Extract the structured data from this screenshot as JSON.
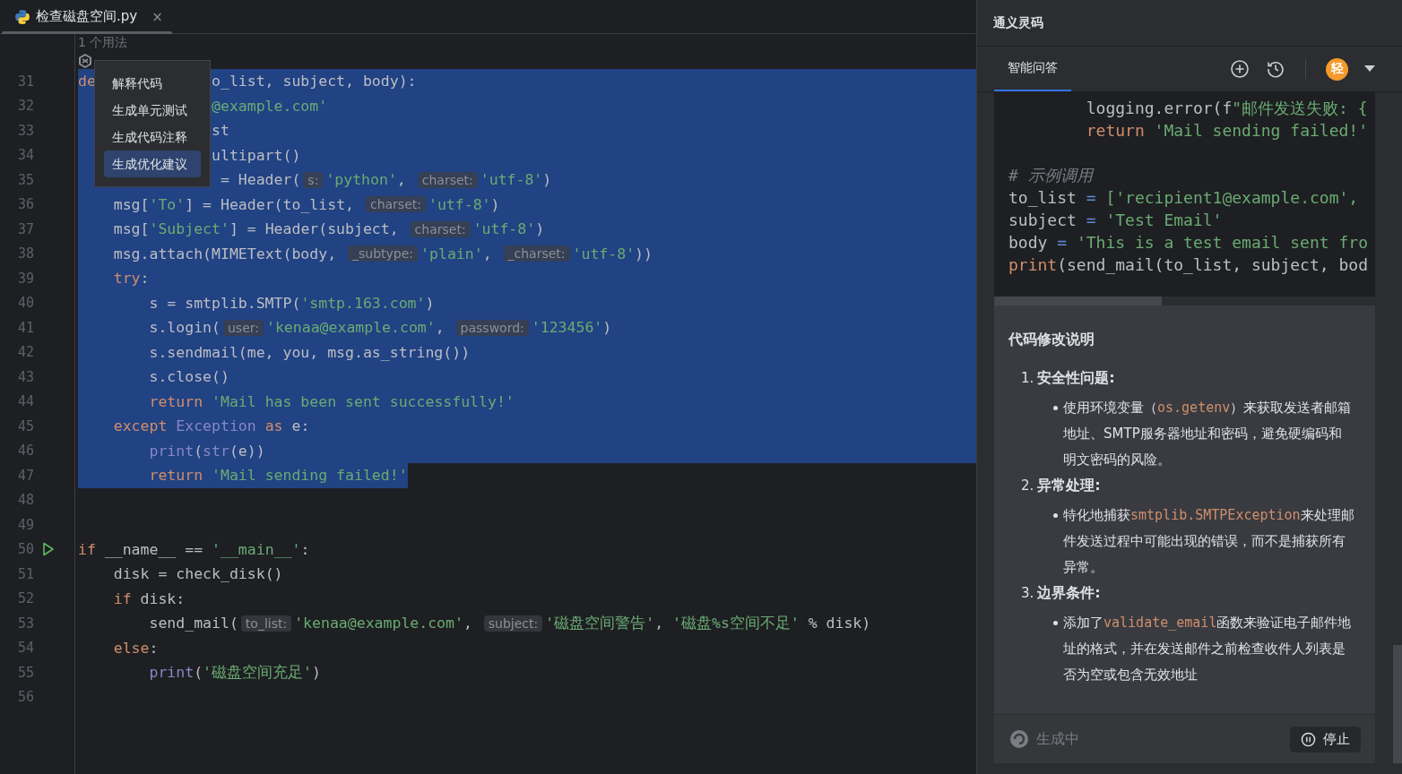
{
  "editor_tab": {
    "label": "检查磁盘空间.py",
    "close": "×",
    "selected": true
  },
  "editor": {
    "usages": "1 个用法",
    "lines": [
      {
        "no": "31",
        "selected": true,
        "tokens": [
          {
            "t": "de",
            "kind": "kw"
          },
          {
            "t": "             o_list, subject, body):",
            "kind": "plain"
          }
        ]
      },
      {
        "no": "32",
        "selected": true,
        "tokens": [
          {
            "t": "               @example.com'",
            "kind": "str"
          }
        ]
      },
      {
        "no": "33",
        "selected": true,
        "tokens": [
          {
            "t": "               st",
            "kind": "plain"
          }
        ]
      },
      {
        "no": "34",
        "selected": true,
        "tokens": [
          {
            "t": "               ultipart()",
            "kind": "plain"
          }
        ]
      },
      {
        "no": "35",
        "selected": true,
        "tokens": [
          {
            "t": "                = Header(",
            "kind": "plain"
          },
          {
            "t": "s:",
            "kind": "hint"
          },
          {
            "t": "'python'",
            "kind": "str"
          },
          {
            "t": ", ",
            "kind": "plain"
          },
          {
            "t": "charset:",
            "kind": "hint"
          },
          {
            "t": "'utf-8'",
            "kind": "str"
          },
          {
            "t": ")",
            "kind": "plain"
          }
        ]
      },
      {
        "no": "36",
        "selected": true,
        "tokens": [
          {
            "t": "    msg[",
            "kind": "plain"
          },
          {
            "t": "'To'",
            "kind": "str"
          },
          {
            "t": "] = Header(to_list, ",
            "kind": "plain"
          },
          {
            "t": "charset:",
            "kind": "hint"
          },
          {
            "t": "'utf-8'",
            "kind": "str"
          },
          {
            "t": ")",
            "kind": "plain"
          }
        ]
      },
      {
        "no": "37",
        "selected": true,
        "tokens": [
          {
            "t": "    msg[",
            "kind": "plain"
          },
          {
            "t": "'Subject'",
            "kind": "str"
          },
          {
            "t": "] = Header(subject, ",
            "kind": "plain"
          },
          {
            "t": "charset:",
            "kind": "hint"
          },
          {
            "t": "'utf-8'",
            "kind": "str"
          },
          {
            "t": ")",
            "kind": "plain"
          }
        ]
      },
      {
        "no": "38",
        "selected": true,
        "tokens": [
          {
            "t": "    msg.attach(MIMEText(body, ",
            "kind": "plain"
          },
          {
            "t": "_subtype:",
            "kind": "hint"
          },
          {
            "t": "'plain'",
            "kind": "str"
          },
          {
            "t": ", ",
            "kind": "plain"
          },
          {
            "t": "_charset:",
            "kind": "hint"
          },
          {
            "t": "'utf-8'",
            "kind": "str"
          },
          {
            "t": "))",
            "kind": "plain"
          }
        ]
      },
      {
        "no": "39",
        "selected": true,
        "tokens": [
          {
            "t": "    try",
            "kind": "kw"
          },
          {
            "t": ":",
            "kind": "plain"
          }
        ]
      },
      {
        "no": "40",
        "selected": true,
        "tokens": [
          {
            "t": "        s = smtplib.SMTP(",
            "kind": "plain"
          },
          {
            "t": "'smtp.163.com'",
            "kind": "str"
          },
          {
            "t": ")",
            "kind": "plain"
          }
        ]
      },
      {
        "no": "41",
        "selected": true,
        "tokens": [
          {
            "t": "        s.login(",
            "kind": "plain"
          },
          {
            "t": "user:",
            "kind": "hint"
          },
          {
            "t": "'kenaa@example.com'",
            "kind": "str"
          },
          {
            "t": ", ",
            "kind": "plain"
          },
          {
            "t": "password:",
            "kind": "hint"
          },
          {
            "t": "'123456'",
            "kind": "str"
          },
          {
            "t": ")",
            "kind": "plain"
          }
        ]
      },
      {
        "no": "42",
        "selected": true,
        "tokens": [
          {
            "t": "        s.sendmail(me, you, msg.as_string())",
            "kind": "plain"
          }
        ]
      },
      {
        "no": "43",
        "selected": true,
        "tokens": [
          {
            "t": "        s.close()",
            "kind": "plain"
          }
        ]
      },
      {
        "no": "44",
        "selected": true,
        "tokens": [
          {
            "t": "        return",
            "kind": "kw"
          },
          {
            "t": " 'Mail has been sent successfully!'",
            "kind": "str"
          }
        ]
      },
      {
        "no": "45",
        "selected": true,
        "tokens": [
          {
            "t": "    except",
            "kind": "kw"
          },
          {
            "t": " Exception",
            "kind": "builtin"
          },
          {
            "t": " as",
            "kind": "kw"
          },
          {
            "t": " e:",
            "kind": "plain"
          }
        ]
      },
      {
        "no": "46",
        "selected": true,
        "tokens": [
          {
            "t": "        print",
            "kind": "builtin"
          },
          {
            "t": "(",
            "kind": "plain"
          },
          {
            "t": "str",
            "kind": "builtin"
          },
          {
            "t": "(e))",
            "kind": "plain"
          }
        ]
      },
      {
        "no": "47",
        "selected": true,
        "tokens": [
          {
            "t": "        return",
            "kind": "kw"
          },
          {
            "t": " 'Mail sending failed!'",
            "kind": "str"
          }
        ]
      },
      {
        "no": "48",
        "selected": false
      },
      {
        "no": "49",
        "selected": false
      },
      {
        "no": "50",
        "selected": false,
        "run": true,
        "tokens": [
          {
            "t": "if",
            "kind": "kw"
          },
          {
            "t": " __name__ == ",
            "kind": "plain"
          },
          {
            "t": "'__main__'",
            "kind": "str"
          },
          {
            "t": ":",
            "kind": "plain"
          }
        ]
      },
      {
        "no": "51",
        "selected": false,
        "tokens": [
          {
            "t": "    disk = check_disk()",
            "kind": "plain"
          }
        ]
      },
      {
        "no": "52",
        "selected": false,
        "tokens": [
          {
            "t": "    if",
            "kind": "kw"
          },
          {
            "t": " disk:",
            "kind": "plain"
          }
        ]
      },
      {
        "no": "53",
        "selected": false,
        "tokens": [
          {
            "t": "        send_mail(",
            "kind": "plain"
          },
          {
            "t": "to_list:",
            "kind": "hint"
          },
          {
            "t": "'kenaa@example.com'",
            "kind": "str"
          },
          {
            "t": ", ",
            "kind": "plain"
          },
          {
            "t": "subject:",
            "kind": "hint"
          },
          {
            "t": "'磁盘空间警告'",
            "kind": "str"
          },
          {
            "t": ", ",
            "kind": "plain"
          },
          {
            "t": "'磁盘%s空间不足'",
            "kind": "str"
          },
          {
            "t": " % disk)",
            "kind": "plain"
          }
        ]
      },
      {
        "no": "54",
        "selected": false,
        "tokens": [
          {
            "t": "    else",
            "kind": "kw"
          },
          {
            "t": ":",
            "kind": "plain"
          }
        ]
      },
      {
        "no": "55",
        "selected": false,
        "tokens": [
          {
            "t": "        print",
            "kind": "builtin"
          },
          {
            "t": "(",
            "kind": "plain"
          },
          {
            "t": "'磁盘空间充足'",
            "kind": "str"
          },
          {
            "t": ")",
            "kind": "plain"
          }
        ]
      },
      {
        "no": "56",
        "selected": false
      }
    ]
  },
  "context_menu": [
    {
      "label": "解释代码",
      "selected": false
    },
    {
      "label": "生成单元测试",
      "selected": false
    },
    {
      "label": "生成代码注释",
      "selected": false
    },
    {
      "label": "生成优化建议",
      "selected": true
    }
  ],
  "assistant": {
    "title": "通义灵码",
    "tabs": [
      {
        "label": "智能问答",
        "selected": true
      }
    ],
    "avatar": "轻",
    "code_block": [
      {
        "kind": "code",
        "tokens": [
          {
            "t": "        logging.error(f",
            "kind": "plain"
          },
          {
            "t": "\"邮件发送失败: {",
            "kind": "str"
          }
        ]
      },
      {
        "kind": "code",
        "tokens": [
          {
            "t": "        return",
            "kind": "kw"
          },
          {
            "t": " 'Mail sending failed!'",
            "kind": "str"
          }
        ]
      },
      {
        "kind": "blank"
      },
      {
        "kind": "code",
        "tokens": [
          {
            "t": "# 示例调用",
            "kind": "comment"
          }
        ]
      },
      {
        "kind": "code",
        "tokens": [
          {
            "t": "to_list ",
            "kind": "plain"
          },
          {
            "t": "=",
            "kind": "op"
          },
          {
            "t": " ['recipient1@example.com',",
            "kind": "str"
          }
        ]
      },
      {
        "kind": "code",
        "tokens": [
          {
            "t": "subject ",
            "kind": "plain"
          },
          {
            "t": "=",
            "kind": "op"
          },
          {
            "t": " 'Test Email'",
            "kind": "str"
          }
        ]
      },
      {
        "kind": "code",
        "tokens": [
          {
            "t": "body ",
            "kind": "plain"
          },
          {
            "t": "=",
            "kind": "op"
          },
          {
            "t": " 'This is a test email sent fro",
            "kind": "str"
          }
        ]
      },
      {
        "kind": "code",
        "tokens": [
          {
            "t": "print",
            "kind": "kw"
          },
          {
            "t": "(send_mail(to_list, subject, bod",
            "kind": "plain"
          }
        ]
      }
    ],
    "explanation": {
      "title": "代码修改说明",
      "items": [
        {
          "number": "1.",
          "heading": "安全性问题:",
          "bullets": [
            [
              {
                "t": "使用环境变量（"
              },
              {
                "t": "os.getenv",
                "code": true
              },
              {
                "t": "）来获取发送者邮箱地址、SMTP服务器地址和密码，避免硬编码和明文密码的风险。"
              }
            ]
          ]
        },
        {
          "number": "2.",
          "heading": "异常处理:",
          "bullets": [
            [
              {
                "t": "特化地捕获"
              },
              {
                "t": "smtplib.SMTPException",
                "code": true
              },
              {
                "t": "来处理邮件发送过程中可能出现的错误，而不是捕获所有异常。"
              }
            ]
          ]
        },
        {
          "number": "3.",
          "heading": "边界条件:",
          "bullets": [
            [
              {
                "t": "添加了"
              },
              {
                "t": "validate_email",
                "code": true
              },
              {
                "t": "函数来验证电子邮件地址的格式，并在发送邮件之前检查收件人列表是否为空或包含无效地址"
              }
            ]
          ]
        }
      ]
    },
    "status": "生成中",
    "stop_button": "停止"
  }
}
